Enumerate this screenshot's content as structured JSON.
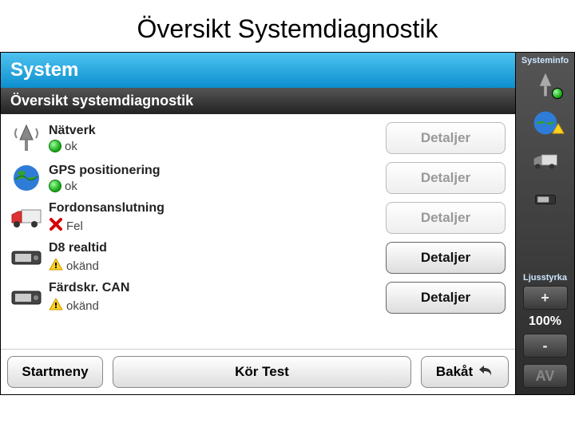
{
  "slide_title": "Översikt Systemdiagnostik",
  "header": {
    "title": "System",
    "subtitle": "Översikt systemdiagnostik"
  },
  "rows": [
    {
      "name": "Nätverk",
      "status": "ok",
      "status_type": "ok",
      "detail_enabled": false
    },
    {
      "name": "GPS positionering",
      "status": "ok",
      "status_type": "ok",
      "detail_enabled": false
    },
    {
      "name": "Fordonsanslutning",
      "status": "Fel",
      "status_type": "error",
      "detail_enabled": false
    },
    {
      "name": "D8 realtid",
      "status": "okänd",
      "status_type": "warn",
      "detail_enabled": true
    },
    {
      "name": "Färdskr. CAN",
      "status": "okänd",
      "status_type": "warn",
      "detail_enabled": true
    }
  ],
  "buttons": {
    "details": "Detaljer",
    "start_menu": "Startmeny",
    "run_test": "Kör Test",
    "back": "Bakåt"
  },
  "sidebar": {
    "info_label": "Systeminfo",
    "brightness_label": "Ljusstyrka",
    "plus": "+",
    "minus": "-",
    "percent": "100%",
    "off": "AV"
  }
}
